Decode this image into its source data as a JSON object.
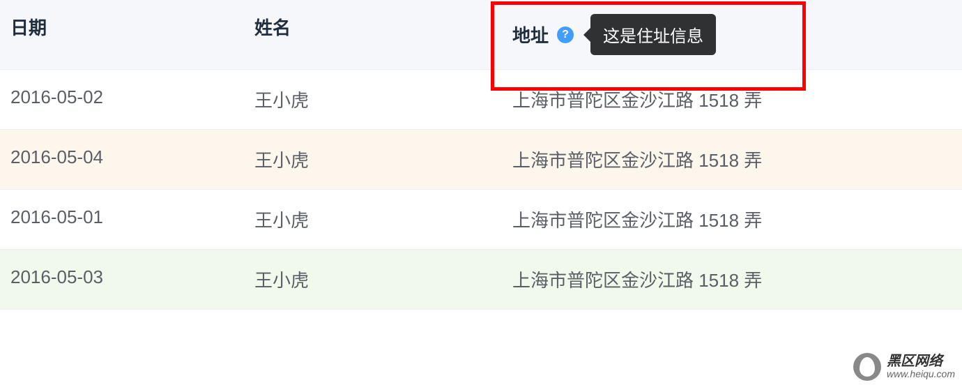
{
  "table": {
    "headers": {
      "date": "日期",
      "name": "姓名",
      "address": "地址"
    },
    "tooltip": "这是住址信息",
    "help_icon": "?",
    "rows": [
      {
        "date": "2016-05-02",
        "name": "王小虎",
        "address": "上海市普陀区金沙江路 1518 弄",
        "row_class": ""
      },
      {
        "date": "2016-05-04",
        "name": "王小虎",
        "address": "上海市普陀区金沙江路 1518 弄",
        "row_class": "row-warning"
      },
      {
        "date": "2016-05-01",
        "name": "王小虎",
        "address": "上海市普陀区金沙江路 1518 弄",
        "row_class": ""
      },
      {
        "date": "2016-05-03",
        "name": "王小虎",
        "address": "上海市普陀区金沙江路 1518 弄",
        "row_class": "row-success"
      }
    ]
  },
  "watermark": {
    "title": "黑区网络",
    "sub": "www.heiqu.com"
  }
}
